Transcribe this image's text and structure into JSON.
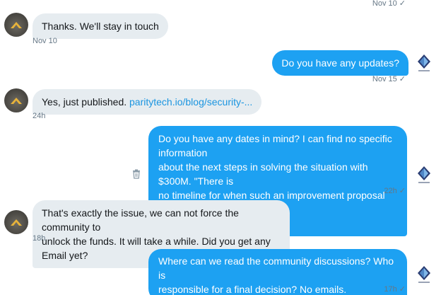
{
  "messages": [
    {
      "timestamp": "Nov 10",
      "check": "✓"
    },
    {
      "text": "Thanks. We'll stay in touch",
      "timestamp": "Nov 10"
    },
    {
      "text": "Do you have any updates?",
      "timestamp": "Nov 15",
      "check": "✓"
    },
    {
      "text": "Yes, just published. ",
      "link": "paritytech.io/blog/security-...",
      "timestamp": "24h"
    },
    {
      "lines": [
        "Do you have any dates in mind? I can find no specific information",
        "about the next steps in solving the situation with $300M. \"There is",
        "no timeline for when such an improvement proposal could be",
        "implemented\""
      ],
      "timestamp": "22h",
      "check": "✓"
    },
    {
      "lines": [
        "That's exactly the issue, we can not force the community to",
        "unlock the funds. It will take a while. Did you get any Email yet?"
      ],
      "timestamp": "18h"
    },
    {
      "lines": [
        "Where can we read the community discussions? Who is",
        "responsible for a final decision? No emails."
      ],
      "timestamp": "17h",
      "check": "✓"
    }
  ],
  "icons": {
    "incoming_avatar": "parity-logo-icon",
    "outgoing_avatar": "diamond-logo-icon",
    "delete": "trash-icon"
  },
  "colors": {
    "outgoing_bubble": "#1da1f2",
    "incoming_bubble": "#e6ecf0",
    "link": "#1b95e0",
    "timestamp": "#657786"
  }
}
